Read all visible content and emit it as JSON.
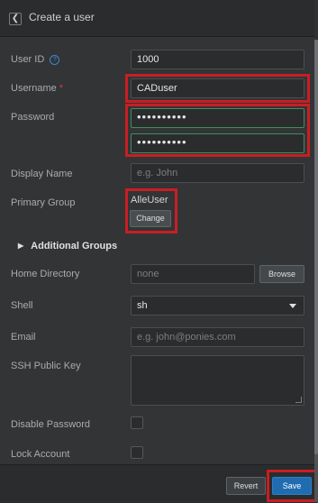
{
  "header": {
    "title": "Create a user",
    "back_icon": "chevron-left-icon"
  },
  "form": {
    "user_id": {
      "label": "User ID",
      "value": "1000",
      "help_icon": "question-circle-icon"
    },
    "username": {
      "label": "Username",
      "required_mark": "*",
      "value": "CADuser"
    },
    "password": {
      "label": "Password",
      "value": "••••••••••",
      "confirm_value": "••••••••••"
    },
    "display_name": {
      "label": "Display Name",
      "placeholder": "e.g. John"
    },
    "primary_group": {
      "label": "Primary Group",
      "value": "AlleUser",
      "change_label": "Change"
    },
    "additional_groups": {
      "label": "Additional Groups",
      "icon": "triangle-right-icon"
    },
    "home_directory": {
      "label": "Home Directory",
      "value": "none",
      "browse_label": "Browse"
    },
    "shell": {
      "label": "Shell",
      "value": "sh"
    },
    "email": {
      "label": "Email",
      "placeholder": "e.g. john@ponies.com"
    },
    "ssh_public_key": {
      "label": "SSH Public Key"
    },
    "disable_password": {
      "label": "Disable Password",
      "checked": false
    },
    "lock_account": {
      "label": "Lock Account",
      "checked": false
    }
  },
  "footer": {
    "revert_label": "Revert",
    "save_label": "Save"
  },
  "colors": {
    "background": "#323436",
    "accent_blue": "#1f6cb0",
    "highlight_red": "#c81e24",
    "required_red": "#d13f3f"
  }
}
